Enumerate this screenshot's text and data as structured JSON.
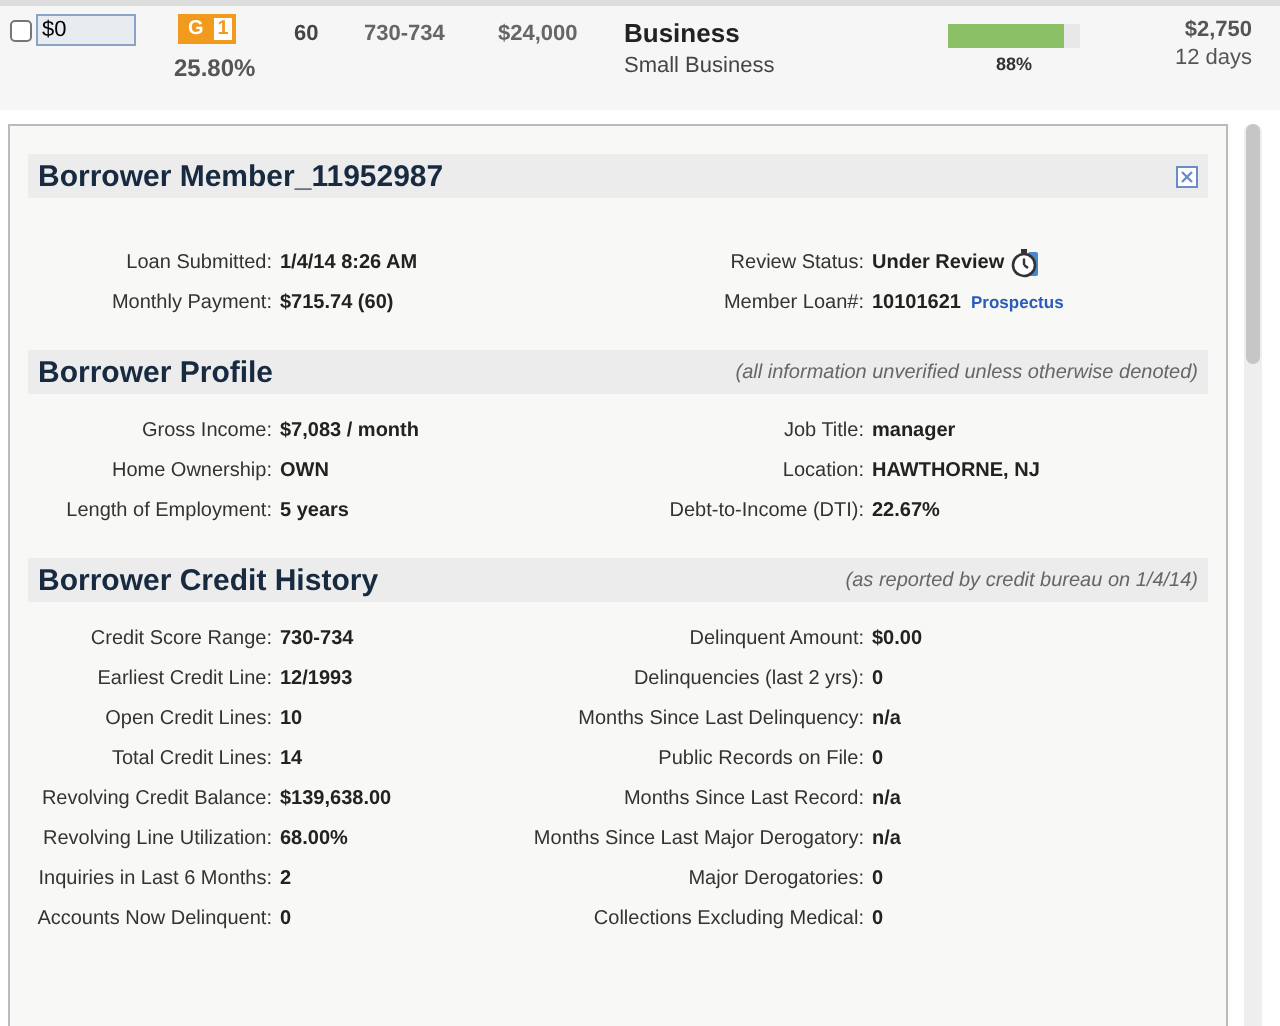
{
  "listing": {
    "selected": false,
    "amount_value": "$0",
    "grade": "G",
    "subgrade": "1",
    "rate": "25.80%",
    "term": "60",
    "fico": "730-734",
    "loan_amount": "$24,000",
    "purpose": "Business",
    "subpurpose": "Small Business",
    "funded": {
      "level": 0.88,
      "label": "88%"
    },
    "remaining": "$2,750",
    "time_left": "12 days"
  },
  "sections": [
    {
      "title": "Borrower Member_11952987",
      "closable": true,
      "rows": [
        {
          "label": "Loan Submitted:",
          "value": "1/4/14 8:26 AM"
        },
        {
          "label": "Review Status:",
          "value": "Under Review",
          "status_icon": true
        },
        {
          "label": "Monthly Payment:",
          "value": "$715.74 (60)"
        },
        {
          "label": "Member Loan#:",
          "value": "10101621",
          "link": "Prospectus"
        }
      ]
    },
    {
      "title": "Borrower Profile",
      "note": "(all information unverified unless otherwise denoted)",
      "rows": [
        {
          "label": "Gross Income:",
          "value": "$7,083 / month"
        },
        {
          "label": "Job Title:",
          "value": "manager"
        },
        {
          "label": "Home Ownership:",
          "value": "OWN"
        },
        {
          "label": "Location:",
          "value": "HAWTHORNE, NJ"
        },
        {
          "label": "Length of Employment:",
          "value": "5 years"
        },
        {
          "label": "Debt-to-Income (DTI):",
          "value": "22.67%"
        }
      ]
    },
    {
      "title": "Borrower Credit History",
      "note": "(as reported by credit bureau on 1/4/14)",
      "rows": [
        {
          "label": "Credit Score Range:",
          "value": "730-734"
        },
        {
          "label": "Delinquent Amount:",
          "value": "$0.00"
        },
        {
          "label": "Earliest Credit Line:",
          "value": "12/1993"
        },
        {
          "label": "Delinquencies (last 2 yrs):",
          "value": "0"
        },
        {
          "label": "Open Credit Lines:",
          "value": "10"
        },
        {
          "label": "Months Since Last Delinquency:",
          "value": "n/a"
        },
        {
          "label": "Total Credit Lines:",
          "value": "14"
        },
        {
          "label": "Public Records on File:",
          "value": "0"
        },
        {
          "label": "Revolving Credit Balance:",
          "value": "$139,638.00"
        },
        {
          "label": "Months Since Last Record:",
          "value": "n/a"
        },
        {
          "label": "Revolving Line Utilization:",
          "value": "68.00%"
        },
        {
          "label": "Months Since Last Major Derogatory:",
          "value": "n/a"
        },
        {
          "label": "Inquiries in Last 6 Months:",
          "value": "2"
        },
        {
          "label": "Major Derogatories:",
          "value": "0"
        },
        {
          "label": "Accounts Now Delinquent:",
          "value": "0"
        },
        {
          "label": "Collections Excluding Medical:",
          "value": "0"
        }
      ]
    }
  ]
}
